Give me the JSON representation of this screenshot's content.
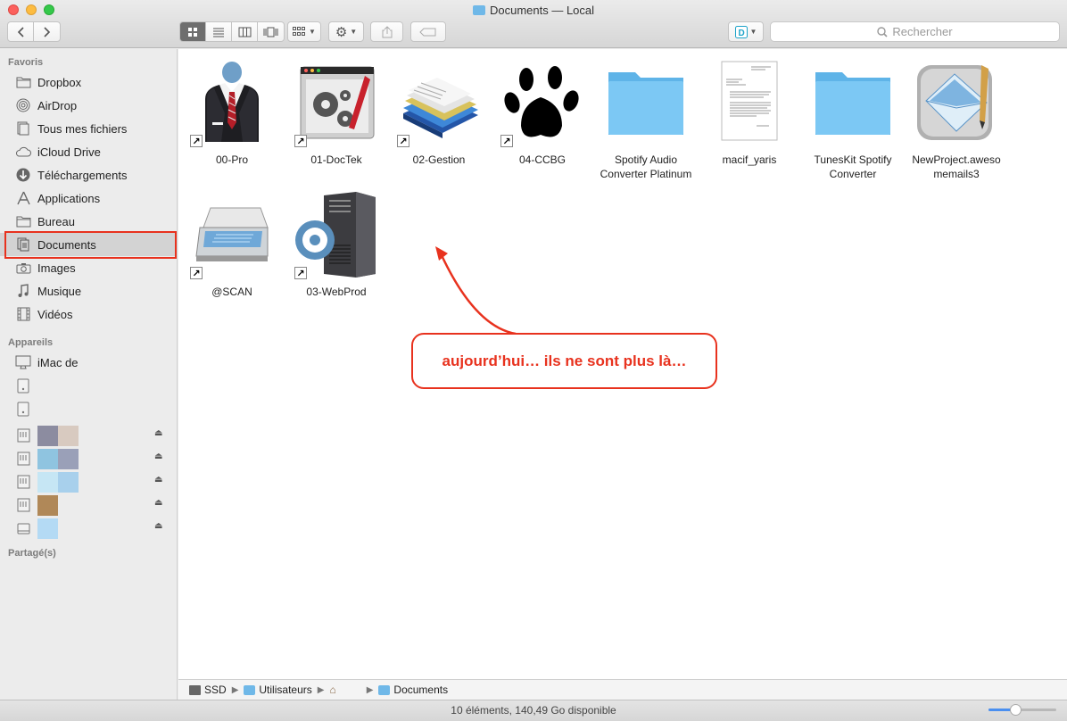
{
  "window": {
    "title": "Documents — Local"
  },
  "toolbar": {
    "search_placeholder": "Rechercher"
  },
  "sidebar": {
    "sections": {
      "favoris": "Favoris",
      "appareils": "Appareils",
      "partages": "Partagé(s)"
    },
    "favoris": [
      {
        "label": "Dropbox",
        "icon": "folder-icon"
      },
      {
        "label": "AirDrop",
        "icon": "airdrop-icon"
      },
      {
        "label": "Tous mes fichiers",
        "icon": "all-files-icon"
      },
      {
        "label": "iCloud Drive",
        "icon": "cloud-icon"
      },
      {
        "label": "Téléchargements",
        "icon": "download-icon"
      },
      {
        "label": "Applications",
        "icon": "applications-icon"
      },
      {
        "label": "Bureau",
        "icon": "folder-icon"
      },
      {
        "label": "Documents",
        "icon": "documents-icon",
        "selected": true
      },
      {
        "label": "Images",
        "icon": "camera-icon"
      },
      {
        "label": "Musique",
        "icon": "music-icon"
      },
      {
        "label": "Vidéos",
        "icon": "film-icon"
      }
    ],
    "appareils": [
      {
        "label": "iMac de",
        "icon": "imac-icon"
      }
    ],
    "swatch_colors": [
      "#8c8ca0",
      "#d8cac0",
      "#8fc4e0",
      "#9aa0b8",
      "#c6e6f4",
      "#a8d0ec",
      "#b08858",
      "#b4daf4"
    ]
  },
  "files": [
    {
      "label": "00-Pro",
      "icon": "suit-icon",
      "alias": true
    },
    {
      "label": "01-DocTek",
      "icon": "gears-pencil-icon",
      "alias": true
    },
    {
      "label": "02-Gestion",
      "icon": "documents-stack-icon",
      "alias": true
    },
    {
      "label": "04-CCBG",
      "icon": "paw-print-icon",
      "alias": true
    },
    {
      "label": "Spotify Audio Converter Platinum",
      "icon": "folder-icon",
      "alias": false
    },
    {
      "label": "macif_yaris",
      "icon": "pdf-document-icon",
      "alias": false
    },
    {
      "label": "TunesKit Spotify Converter",
      "icon": "folder-icon",
      "alias": false
    },
    {
      "label": "NewProject.awesomemails3",
      "label_display": "NewProject.aweso memails3",
      "icon": "mail-pencil-icon",
      "alias": false
    },
    {
      "label": "@SCAN",
      "icon": "scanner-icon",
      "alias": true
    },
    {
      "label": "03-WebProd",
      "icon": "server-gear-icon",
      "alias": true
    }
  ],
  "annotation": {
    "text": "aujourd’hui… ils ne sont plus là…",
    "color": "#e8321e"
  },
  "pathbar": {
    "items": [
      "SSD",
      "Utilisateurs",
      "",
      "Documents"
    ]
  },
  "statusbar": {
    "text": "10 éléments, 140,49 Go disponible"
  }
}
